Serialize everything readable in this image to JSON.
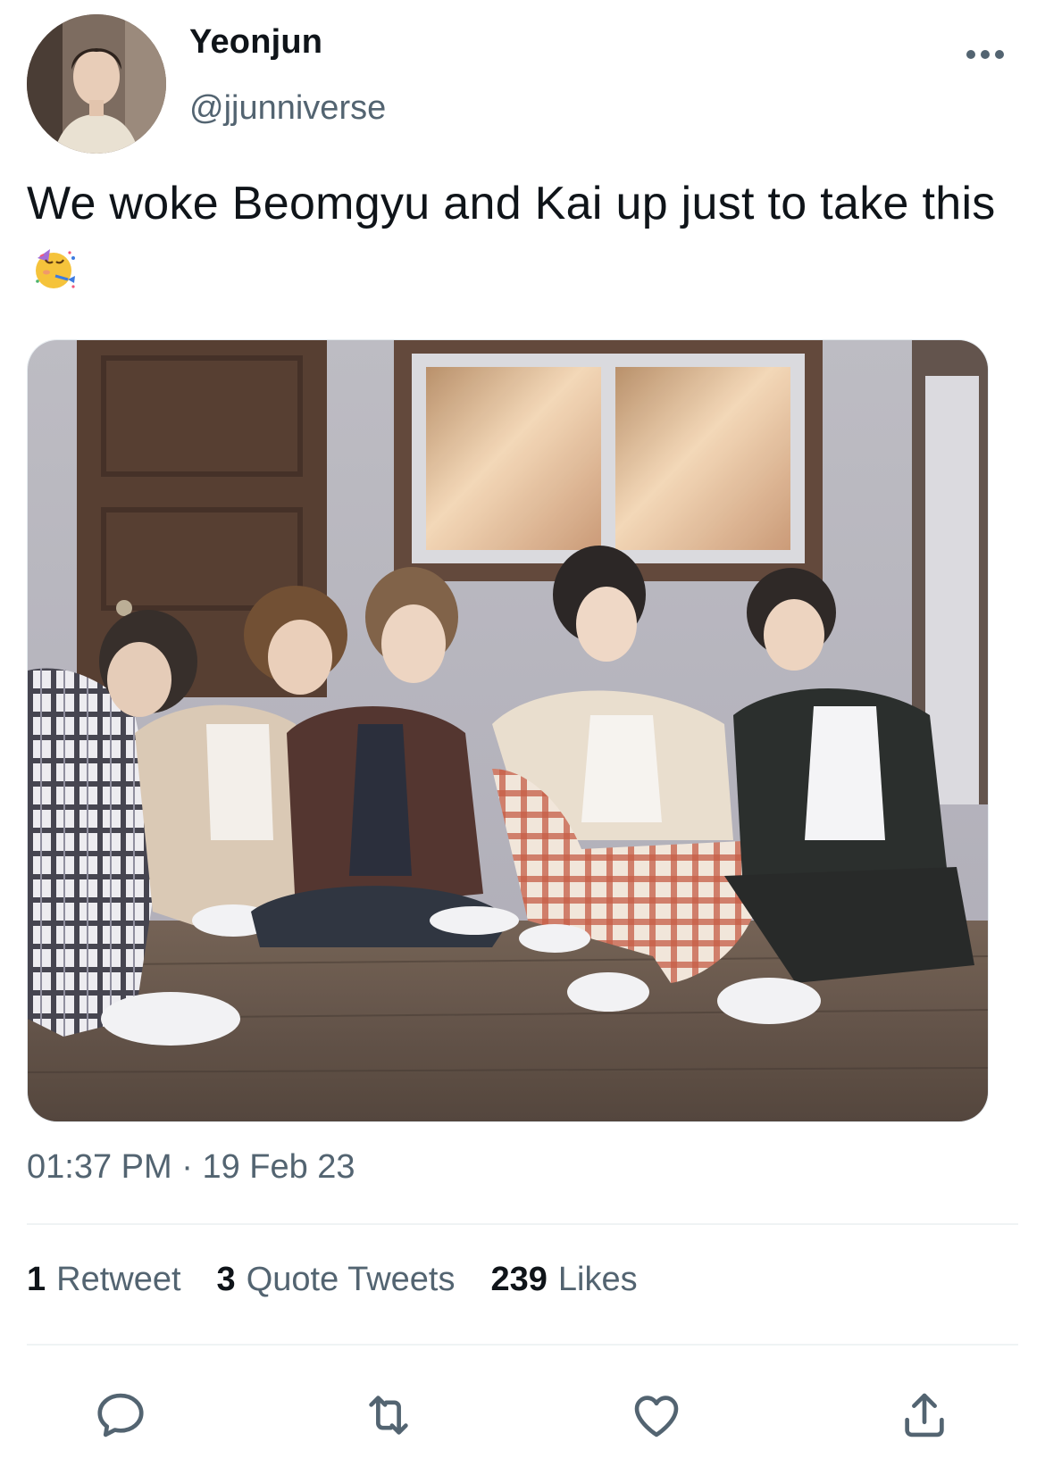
{
  "author": {
    "display_name": "Yeonjun",
    "handle": "@jjunniverse"
  },
  "tweet": {
    "text": "We woke Beomgyu and Kai up just to take this",
    "emoji": "partying-face-emoji",
    "timestamp_time": "01:37 PM",
    "timestamp_sep": " · ",
    "timestamp_date": "19 Feb 23"
  },
  "stats": {
    "retweets_count": "1",
    "retweets_label": "Retweet",
    "quotes_count": "3",
    "quotes_label": "Quote Tweets",
    "likes_count": "239",
    "likes_label": "Likes"
  },
  "icons": {
    "more": "more-icon",
    "reply": "reply-icon",
    "retweet": "retweet-icon",
    "like": "heart-icon",
    "share": "share-icon"
  },
  "colors": {
    "text_primary": "#0f1419",
    "text_secondary": "#536471",
    "divider": "#eff3f4"
  }
}
